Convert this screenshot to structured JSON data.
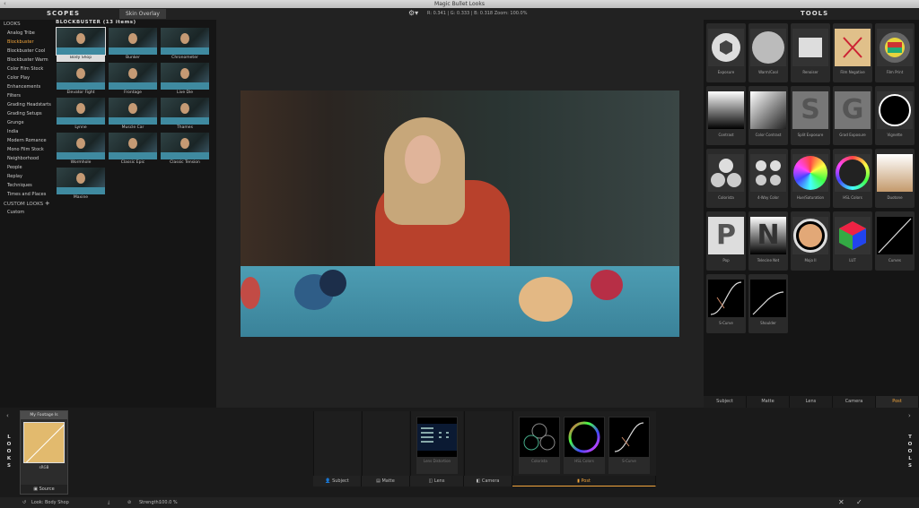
{
  "window": {
    "title": "Magic Bullet Looks"
  },
  "topbar": {
    "scopes_label": "SCOPES",
    "skin_overlay_label": "Skin Overlay",
    "readout": "R: 0.341 | G: 0.333 | B: 0.318    Zoom: 100.0%",
    "tools_label": "TOOLS"
  },
  "looks": {
    "header": "LOOKS",
    "categories": [
      {
        "label": "Analog Tribe"
      },
      {
        "label": "Blockbuster"
      },
      {
        "label": "Blockbuster Cool"
      },
      {
        "label": "Blockbuster Warm"
      },
      {
        "label": "Color Film Stock"
      },
      {
        "label": "Color Play"
      },
      {
        "label": "Enhancements"
      },
      {
        "label": "Filters"
      },
      {
        "label": "Grading Headstarts"
      },
      {
        "label": "Grading Setups"
      },
      {
        "label": "Grunge"
      },
      {
        "label": "India"
      },
      {
        "label": "Modern Romance"
      },
      {
        "label": "Mono Film Stock"
      },
      {
        "label": "Neighborhood"
      },
      {
        "label": "People"
      },
      {
        "label": "Replay"
      },
      {
        "label": "Techniques"
      },
      {
        "label": "Times and Places"
      }
    ],
    "custom_header": "CUSTOM LOOKS",
    "custom_plus": "+",
    "custom_items": [
      {
        "label": "Custom"
      }
    ]
  },
  "look_group": {
    "title": "BLOCKBUSTER (13 items)",
    "thumbs": [
      {
        "label": "Body Shop"
      },
      {
        "label": "Bunker"
      },
      {
        "label": "Chronometer"
      },
      {
        "label": "Elevator Fight"
      },
      {
        "label": "Frontage"
      },
      {
        "label": "Live Die"
      },
      {
        "label": "Lynne"
      },
      {
        "label": "Muscle Car"
      },
      {
        "label": "Thames"
      },
      {
        "label": "Wormhole"
      },
      {
        "label": "Classic Epic"
      },
      {
        "label": "Classic Tension"
      },
      {
        "label": "Maxine"
      }
    ]
  },
  "tools": {
    "items": [
      {
        "label": "Exposure",
        "icon": "exposure-icon"
      },
      {
        "label": "Warm/Cool",
        "icon": "warm-cool-icon"
      },
      {
        "label": "Renoiser",
        "icon": "renoiser-icon"
      },
      {
        "label": "Film Negative",
        "icon": "film-negative-icon"
      },
      {
        "label": "Film Print",
        "icon": "film-print-icon"
      },
      {
        "label": "Contrast",
        "icon": "contrast-icon"
      },
      {
        "label": "Color Contrast",
        "icon": "color-contrast-icon"
      },
      {
        "label": "Split Exposure",
        "icon": "split-exposure-icon"
      },
      {
        "label": "Grad Exposure",
        "icon": "grad-exposure-icon"
      },
      {
        "label": "Vignette",
        "icon": "vignette-icon"
      },
      {
        "label": "Colorista",
        "icon": "colorista-icon"
      },
      {
        "label": "4-Way Color",
        "icon": "four-way-color-icon"
      },
      {
        "label": "Hue/Saturation",
        "icon": "hue-saturation-icon"
      },
      {
        "label": "HSL Colors",
        "icon": "hsl-colors-icon"
      },
      {
        "label": "Duotone",
        "icon": "duotone-icon"
      },
      {
        "label": "Pop",
        "icon": "pop-icon"
      },
      {
        "label": "Telecine Net",
        "icon": "telecine-net-icon"
      },
      {
        "label": "Mojo II",
        "icon": "mojo-icon"
      },
      {
        "label": "LUT",
        "icon": "lut-icon"
      },
      {
        "label": "Curves",
        "icon": "curves-icon"
      },
      {
        "label": "S-Curve",
        "icon": "s-curve-icon"
      },
      {
        "label": "Shoulder",
        "icon": "shoulder-icon"
      }
    ],
    "tabs": [
      {
        "label": "Subject"
      },
      {
        "label": "Matte"
      },
      {
        "label": "Lens"
      },
      {
        "label": "Camera"
      },
      {
        "label": "Post"
      }
    ]
  },
  "bottom": {
    "looks_side_label": [
      "L",
      "O",
      "O",
      "K",
      "S"
    ],
    "tools_side_label": [
      "T",
      "O",
      "O",
      "L",
      "S"
    ],
    "footage": {
      "title": "My Footage Is",
      "caption": "sRGB",
      "source_label": "Source"
    },
    "stack_tools": [
      {
        "label": "Lens Distortion"
      },
      {
        "label": "Colorista"
      },
      {
        "label": "HSL Colors"
      },
      {
        "label": "S-Curve"
      }
    ],
    "stack_tabs": [
      {
        "label": "Subject"
      },
      {
        "label": "Matte"
      },
      {
        "label": "Lens"
      },
      {
        "label": "Camera"
      },
      {
        "label": "Post"
      }
    ]
  },
  "status": {
    "look_label": "Look:",
    "look_value": "Body Shop",
    "strength_label": "Strength:",
    "strength_value": "100.0 %"
  },
  "colors": {
    "accent": "#f2a53c"
  }
}
